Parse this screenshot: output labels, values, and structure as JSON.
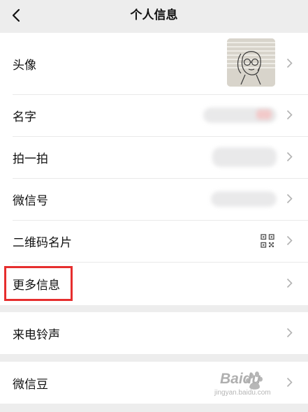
{
  "nav": {
    "title": "个人信息"
  },
  "rows": {
    "avatar": {
      "label": "头像"
    },
    "name": {
      "label": "名字"
    },
    "pat": {
      "label": "拍一拍"
    },
    "wechat_id": {
      "label": "微信号"
    },
    "qr_card": {
      "label": "二维码名片"
    },
    "more_info": {
      "label": "更多信息"
    },
    "ringtone": {
      "label": "来电铃声"
    },
    "wechat_beans": {
      "label": "微信豆"
    }
  },
  "watermark": {
    "text": "Baidu",
    "sub": "jingyan.baidu.com"
  },
  "icons": {
    "back": "chevron-left-icon",
    "row_arrow": "chevron-right-icon",
    "qr": "qr-code-icon"
  },
  "colors": {
    "page_bg": "#ededed",
    "cell_bg": "#ffffff",
    "highlight": "#e62e2e",
    "chevron": "#b2b2b2"
  }
}
